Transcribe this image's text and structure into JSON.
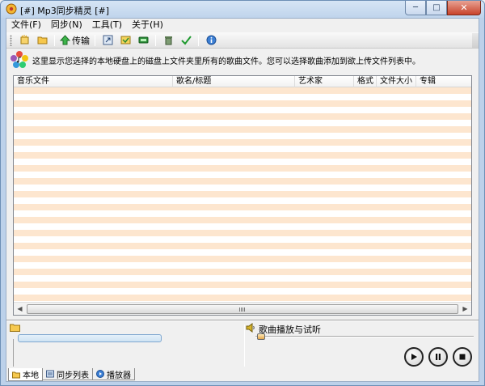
{
  "window": {
    "title": "[#] Mp3同步精灵 [#]",
    "controls": {
      "minimize": "─",
      "maximize": "□",
      "close": "✕"
    }
  },
  "menu": [
    {
      "label": "文件(F)"
    },
    {
      "label": "同步(N)"
    },
    {
      "label": "工具(T)"
    },
    {
      "label": "关于(H)"
    }
  ],
  "toolbar": {
    "transfer_label": "传输",
    "icons": [
      "new-icon",
      "open-folder-icon",
      "transfer-icon",
      "export-icon",
      "import-icon",
      "device-icon",
      "recycle-icon",
      "check-icon",
      "info-icon"
    ]
  },
  "info": {
    "text": "这里显示您选择的本地硬盘上的磁盘上文件夹里所有的歌曲文件。您可以选择歌曲添加到欲上传文件列表中。"
  },
  "list": {
    "columns": [
      {
        "label": "音乐文件"
      },
      {
        "label": "歌名/标题"
      },
      {
        "label": "艺术家"
      },
      {
        "label": "格式"
      },
      {
        "label": "文件大小"
      },
      {
        "label": "专辑"
      }
    ],
    "rows": []
  },
  "player": {
    "label": "歌曲播放与试听",
    "position": 0
  },
  "progress": {
    "value": 0
  },
  "tabs": [
    {
      "label": "本地",
      "icon": "folder-icon",
      "active": true
    },
    {
      "label": "同步列表",
      "icon": "sync-list-icon",
      "active": false
    },
    {
      "label": "播放器",
      "icon": "player-icon",
      "active": false
    }
  ],
  "colors": {
    "row_stripe": "#fde6cf",
    "row_plain": "#ffffff",
    "titlebar": "#bfd4ec",
    "close_button": "#c8432b"
  }
}
